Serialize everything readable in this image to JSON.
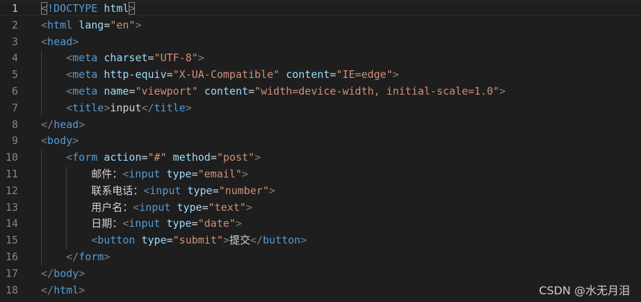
{
  "editor": {
    "active_line": 1,
    "line_numbers": [
      "1",
      "2",
      "3",
      "4",
      "5",
      "6",
      "7",
      "8",
      "9",
      "10",
      "11",
      "12",
      "13",
      "14",
      "15",
      "16",
      "17",
      "18"
    ],
    "lines": [
      [
        {
          "c": "p",
          "t": "<"
        },
        {
          "c": "t",
          "t": "!DOCTYPE"
        },
        {
          "c": "x",
          "t": " "
        },
        {
          "c": "a",
          "t": "html"
        },
        {
          "c": "p",
          "t": ">"
        }
      ],
      [
        {
          "c": "p",
          "t": "<"
        },
        {
          "c": "t",
          "t": "html"
        },
        {
          "c": "x",
          "t": " "
        },
        {
          "c": "a",
          "t": "lang"
        },
        {
          "c": "x",
          "t": "="
        },
        {
          "c": "s",
          "t": "\"en\""
        },
        {
          "c": "p",
          "t": ">"
        }
      ],
      [
        {
          "c": "p",
          "t": "<"
        },
        {
          "c": "t",
          "t": "head"
        },
        {
          "c": "p",
          "t": ">"
        }
      ],
      [
        {
          "c": "x",
          "t": "    "
        },
        {
          "c": "p",
          "t": "<"
        },
        {
          "c": "t",
          "t": "meta"
        },
        {
          "c": "x",
          "t": " "
        },
        {
          "c": "a",
          "t": "charset"
        },
        {
          "c": "x",
          "t": "="
        },
        {
          "c": "s",
          "t": "\"UTF-8\""
        },
        {
          "c": "p",
          "t": ">"
        }
      ],
      [
        {
          "c": "x",
          "t": "    "
        },
        {
          "c": "p",
          "t": "<"
        },
        {
          "c": "t",
          "t": "meta"
        },
        {
          "c": "x",
          "t": " "
        },
        {
          "c": "a",
          "t": "http-equiv"
        },
        {
          "c": "x",
          "t": "="
        },
        {
          "c": "s",
          "t": "\"X-UA-Compatible\""
        },
        {
          "c": "x",
          "t": " "
        },
        {
          "c": "a",
          "t": "content"
        },
        {
          "c": "x",
          "t": "="
        },
        {
          "c": "s",
          "t": "\"IE=edge\""
        },
        {
          "c": "p",
          "t": ">"
        }
      ],
      [
        {
          "c": "x",
          "t": "    "
        },
        {
          "c": "p",
          "t": "<"
        },
        {
          "c": "t",
          "t": "meta"
        },
        {
          "c": "x",
          "t": " "
        },
        {
          "c": "a",
          "t": "name"
        },
        {
          "c": "x",
          "t": "="
        },
        {
          "c": "s",
          "t": "\"viewport\""
        },
        {
          "c": "x",
          "t": " "
        },
        {
          "c": "a",
          "t": "content"
        },
        {
          "c": "x",
          "t": "="
        },
        {
          "c": "s",
          "t": "\"width=device-width, initial-scale=1.0\""
        },
        {
          "c": "p",
          "t": ">"
        }
      ],
      [
        {
          "c": "x",
          "t": "    "
        },
        {
          "c": "p",
          "t": "<"
        },
        {
          "c": "t",
          "t": "title"
        },
        {
          "c": "p",
          "t": ">"
        },
        {
          "c": "x",
          "t": "input"
        },
        {
          "c": "p",
          "t": "</"
        },
        {
          "c": "t",
          "t": "title"
        },
        {
          "c": "p",
          "t": ">"
        }
      ],
      [
        {
          "c": "p",
          "t": "</"
        },
        {
          "c": "t",
          "t": "head"
        },
        {
          "c": "p",
          "t": ">"
        }
      ],
      [
        {
          "c": "p",
          "t": "<"
        },
        {
          "c": "t",
          "t": "body"
        },
        {
          "c": "p",
          "t": ">"
        }
      ],
      [
        {
          "c": "x",
          "t": "    "
        },
        {
          "c": "p",
          "t": "<"
        },
        {
          "c": "t",
          "t": "form"
        },
        {
          "c": "x",
          "t": " "
        },
        {
          "c": "a",
          "t": "action"
        },
        {
          "c": "x",
          "t": "="
        },
        {
          "c": "s",
          "t": "\"#\""
        },
        {
          "c": "x",
          "t": " "
        },
        {
          "c": "a",
          "t": "method"
        },
        {
          "c": "x",
          "t": "="
        },
        {
          "c": "s",
          "t": "\"post\""
        },
        {
          "c": "p",
          "t": ">"
        }
      ],
      [
        {
          "c": "x",
          "t": "        邮件："
        },
        {
          "c": "p",
          "t": "<"
        },
        {
          "c": "t",
          "t": "input"
        },
        {
          "c": "x",
          "t": " "
        },
        {
          "c": "a",
          "t": "type"
        },
        {
          "c": "x",
          "t": "="
        },
        {
          "c": "s",
          "t": "\"email\""
        },
        {
          "c": "p",
          "t": ">"
        }
      ],
      [
        {
          "c": "x",
          "t": "        联系电话："
        },
        {
          "c": "p",
          "t": "<"
        },
        {
          "c": "t",
          "t": "input"
        },
        {
          "c": "x",
          "t": " "
        },
        {
          "c": "a",
          "t": "type"
        },
        {
          "c": "x",
          "t": "="
        },
        {
          "c": "s",
          "t": "\"number\""
        },
        {
          "c": "p",
          "t": ">"
        }
      ],
      [
        {
          "c": "x",
          "t": "        用户名："
        },
        {
          "c": "p",
          "t": "<"
        },
        {
          "c": "t",
          "t": "input"
        },
        {
          "c": "x",
          "t": " "
        },
        {
          "c": "a",
          "t": "type"
        },
        {
          "c": "x",
          "t": "="
        },
        {
          "c": "s",
          "t": "\"text\""
        },
        {
          "c": "p",
          "t": ">"
        }
      ],
      [
        {
          "c": "x",
          "t": "        日期："
        },
        {
          "c": "p",
          "t": "<"
        },
        {
          "c": "t",
          "t": "input"
        },
        {
          "c": "x",
          "t": " "
        },
        {
          "c": "a",
          "t": "type"
        },
        {
          "c": "x",
          "t": "="
        },
        {
          "c": "s",
          "t": "\"date\""
        },
        {
          "c": "p",
          "t": ">"
        }
      ],
      [
        {
          "c": "x",
          "t": "        "
        },
        {
          "c": "p",
          "t": "<"
        },
        {
          "c": "t",
          "t": "button"
        },
        {
          "c": "x",
          "t": " "
        },
        {
          "c": "a",
          "t": "type"
        },
        {
          "c": "x",
          "t": "="
        },
        {
          "c": "s",
          "t": "\"submit\""
        },
        {
          "c": "p",
          "t": ">"
        },
        {
          "c": "x",
          "t": "提交"
        },
        {
          "c": "p",
          "t": "</"
        },
        {
          "c": "t",
          "t": "button"
        },
        {
          "c": "p",
          "t": ">"
        }
      ],
      [
        {
          "c": "x",
          "t": "    "
        },
        {
          "c": "p",
          "t": "</"
        },
        {
          "c": "t",
          "t": "form"
        },
        {
          "c": "p",
          "t": ">"
        }
      ],
      [
        {
          "c": "p",
          "t": "</"
        },
        {
          "c": "t",
          "t": "body"
        },
        {
          "c": "p",
          "t": ">"
        }
      ],
      [
        {
          "c": "p",
          "t": "</"
        },
        {
          "c": "t",
          "t": "html"
        },
        {
          "c": "p",
          "t": ">"
        }
      ]
    ],
    "indent_levels": [
      0,
      0,
      0,
      1,
      1,
      1,
      1,
      0,
      0,
      1,
      2,
      2,
      2,
      2,
      2,
      1,
      0,
      0
    ]
  },
  "colors": {
    "background": "#1e1e1e",
    "line_number": "#858585",
    "line_number_active": "#c6c6c6",
    "punctuation": "#808080",
    "tag": "#569cd6",
    "attribute": "#9cdcfe",
    "string": "#ce9178",
    "text": "#d4d4d4"
  },
  "watermark": "CSDN @水无月泪"
}
